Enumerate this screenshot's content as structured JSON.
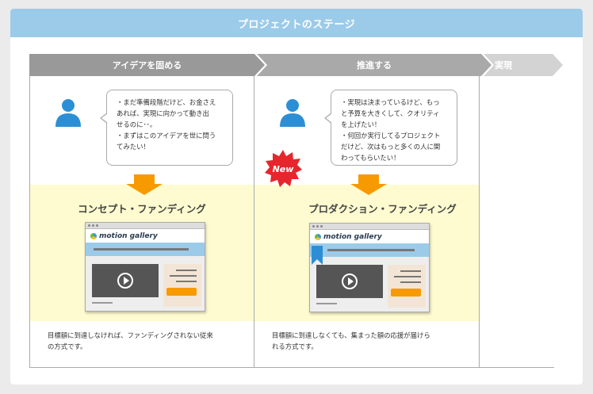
{
  "header": {
    "title": "プロジェクトのステージ"
  },
  "stages": [
    {
      "label": "アイデアを固める"
    },
    {
      "label": "推進する"
    },
    {
      "label": "実現"
    }
  ],
  "columns": [
    {
      "bubble_lines": [
        "・まだ準備段階だけど、お金さえ",
        "あれば、実現に向かって動き出",
        "せるのに･･。",
        "・まずはこのアイデアを世に問う",
        "てみたい！"
      ],
      "product_title": "コンセプト・ファンディング",
      "browser_logo": "motion gallery",
      "desc_lines": [
        "目標額に到達しなければ、ファンディングされない従来",
        "の方式です。"
      ]
    },
    {
      "bubble_lines": [
        "・実現は決まっているけど、もっ",
        "と予算を大きくして、クオリティ",
        "を上げたい！",
        "・何回か実行してるプロジェクト",
        "だけど、次はもっと多くの人に関",
        "わってもらいたい！"
      ],
      "product_title": "プロダクション・ファンディング",
      "badge": "New",
      "browser_logo": "motion gallery",
      "desc_lines": [
        "目標額に到達しなくても、集まった額の応援が届けら",
        "れる方式です。"
      ]
    }
  ],
  "colors": {
    "header_bg": "#9ccbea",
    "accent_orange": "#f79a00",
    "person_blue": "#2c8fd6",
    "badge_red": "#e5262d",
    "highlight_yellow": "#fefbd0"
  },
  "icons": [
    "person-icon",
    "arrow-down-icon",
    "play-icon",
    "bookmark-ribbon-icon",
    "new-badge-icon"
  ]
}
